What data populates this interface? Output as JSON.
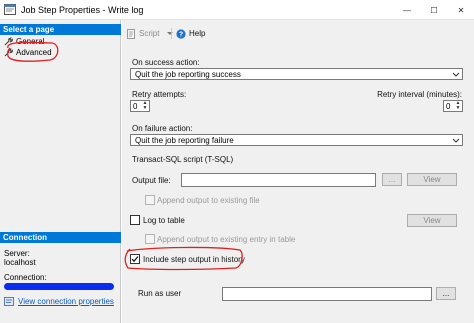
{
  "window": {
    "title": "Job Step Properties - Write log",
    "min_glyph": "—",
    "max_glyph": "☐",
    "close_glyph": "✕"
  },
  "left_pane": {
    "select_page_header": "Select a page",
    "items": [
      {
        "label": "General",
        "icon": "wrench-icon"
      },
      {
        "label": "Advanced",
        "icon": "wrench-icon"
      }
    ],
    "connection_header": "Connection",
    "server_label": "Server:",
    "server_value": "localhost",
    "connection_label": "Connection:",
    "view_connection_link": "View connection properties"
  },
  "toolbar": {
    "script_label": "Script",
    "help_label": "Help"
  },
  "form": {
    "on_success_label": "On success action:",
    "on_success_value": "Quit the job reporting success",
    "retry_attempts_label": "Retry attempts:",
    "retry_attempts_value": "0",
    "retry_interval_label": "Retry interval (minutes):",
    "retry_interval_value": "0",
    "on_failure_label": "On failure action:",
    "on_failure_value": "Quit the job reporting failure",
    "tsql_section_label": "Transact-SQL script (T-SQL)",
    "output_file_label": "Output file:",
    "output_file_value": "",
    "browse_label": "...",
    "view_label": "View",
    "append_output_label": "Append output to existing file",
    "log_to_table_label": "Log to table",
    "view_table_label": "View",
    "append_entry_label": "Append output to existing entry in table",
    "include_history_label": "Include step output in history",
    "include_history_checked": true,
    "run_as_user_label": "Run as user",
    "run_as_user_value": "",
    "run_as_browse_label": "..."
  },
  "annotation_color": "#e02020"
}
